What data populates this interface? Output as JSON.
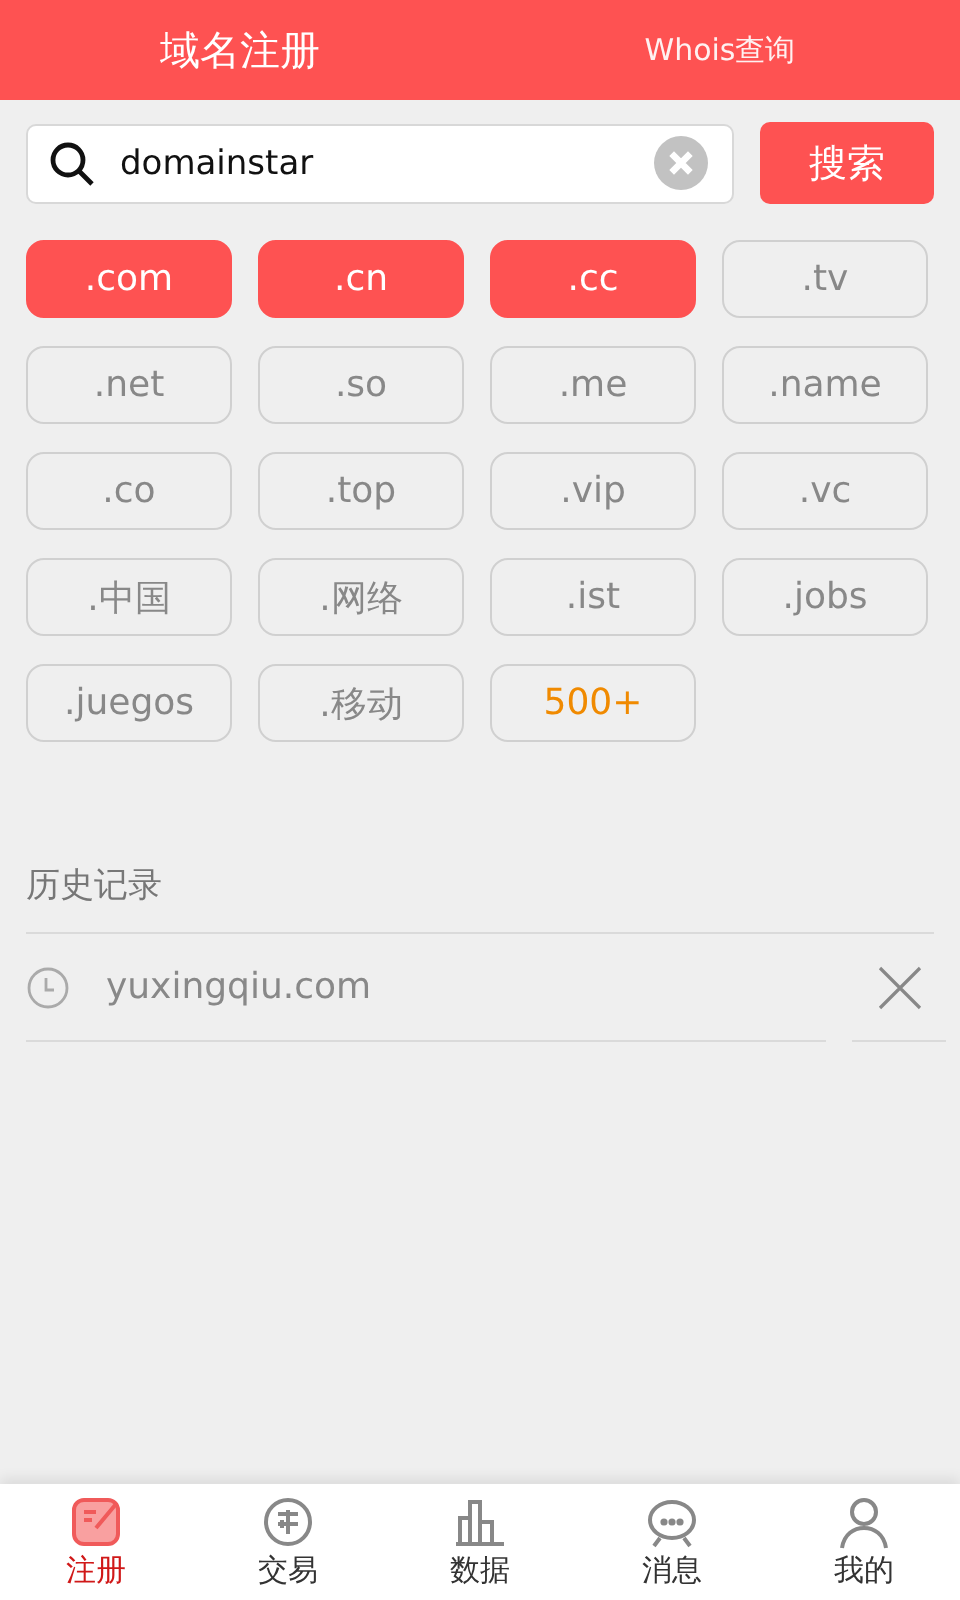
{
  "header": {
    "tabs": [
      {
        "label": "域名注册",
        "selected": true
      },
      {
        "label": "Whois查询",
        "selected": false
      }
    ]
  },
  "search": {
    "value": "domainstar",
    "button": "搜索"
  },
  "extensions": [
    {
      "label": ".com",
      "selected": true,
      "kind": "suffix"
    },
    {
      "label": ".cn",
      "selected": true,
      "kind": "suffix"
    },
    {
      "label": ".cc",
      "selected": true,
      "kind": "suffix"
    },
    {
      "label": ".tv",
      "selected": false,
      "kind": "suffix"
    },
    {
      "label": ".net",
      "selected": false,
      "kind": "suffix"
    },
    {
      "label": ".so",
      "selected": false,
      "kind": "suffix"
    },
    {
      "label": ".me",
      "selected": false,
      "kind": "suffix"
    },
    {
      "label": ".name",
      "selected": false,
      "kind": "suffix"
    },
    {
      "label": ".co",
      "selected": false,
      "kind": "suffix"
    },
    {
      "label": ".top",
      "selected": false,
      "kind": "suffix"
    },
    {
      "label": ".vip",
      "selected": false,
      "kind": "suffix"
    },
    {
      "label": ".vc",
      "selected": false,
      "kind": "suffix"
    },
    {
      "label": ".中国",
      "selected": false,
      "kind": "suffix"
    },
    {
      "label": ".网络",
      "selected": false,
      "kind": "suffix"
    },
    {
      "label": ".ist",
      "selected": false,
      "kind": "suffix"
    },
    {
      "label": ".jobs",
      "selected": false,
      "kind": "suffix"
    },
    {
      "label": ".juegos",
      "selected": false,
      "kind": "suffix"
    },
    {
      "label": ".移动",
      "selected": false,
      "kind": "suffix"
    },
    {
      "label": "500+",
      "selected": false,
      "kind": "more"
    }
  ],
  "history": {
    "title": "历史记录",
    "items": [
      "yuxingqiu.com"
    ]
  },
  "bottom_nav": [
    {
      "label": "注册",
      "kind": "register",
      "selected": true
    },
    {
      "label": "交易",
      "kind": "trade",
      "selected": false
    },
    {
      "label": "数据",
      "kind": "data",
      "selected": false
    },
    {
      "label": "消息",
      "kind": "message",
      "selected": false
    },
    {
      "label": "我的",
      "kind": "profile",
      "selected": false
    }
  ]
}
